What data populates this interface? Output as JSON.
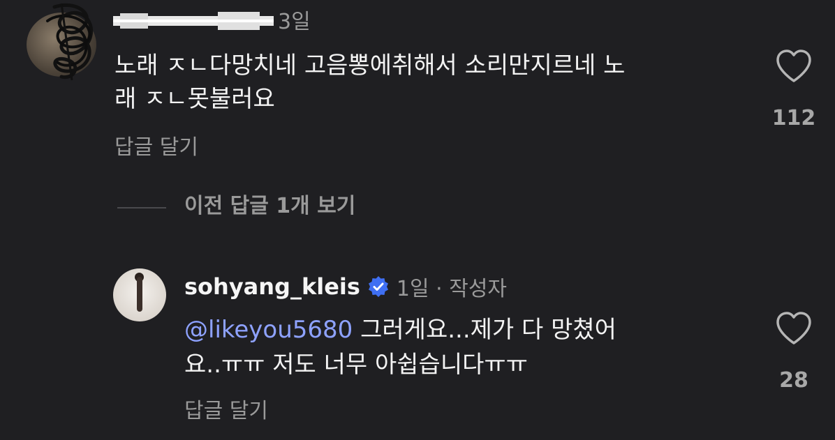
{
  "comments": [
    {
      "time": "3일",
      "text": "노래 ㅈㄴ다망치네 고음뽕에취해서 소리만지르네 노\n래 ㅈㄴ못불러요",
      "reply_label": "답글 달기",
      "likes": "112"
    }
  ],
  "view_previous": "이전 답글 1개 보기",
  "reply": {
    "username": "sohyang_kleis",
    "time": "1일 · 작성자",
    "mention": "@likeyou5680",
    "text": " 그러게요...제가 다 망쳤어\n요..ㅠㅠ 저도 너무 아쉽습니다ㅠㅠ",
    "reply_label": "답글 달기",
    "likes": "28"
  },
  "icons": {
    "like": "heart-outline-icon",
    "verified": "verified-badge-icon"
  },
  "colors": {
    "background": "#1f1f22",
    "text": "#f3f3f3",
    "muted": "#9a9a9a",
    "mention": "#8ea2ff",
    "verified": "#3f6ff2"
  }
}
